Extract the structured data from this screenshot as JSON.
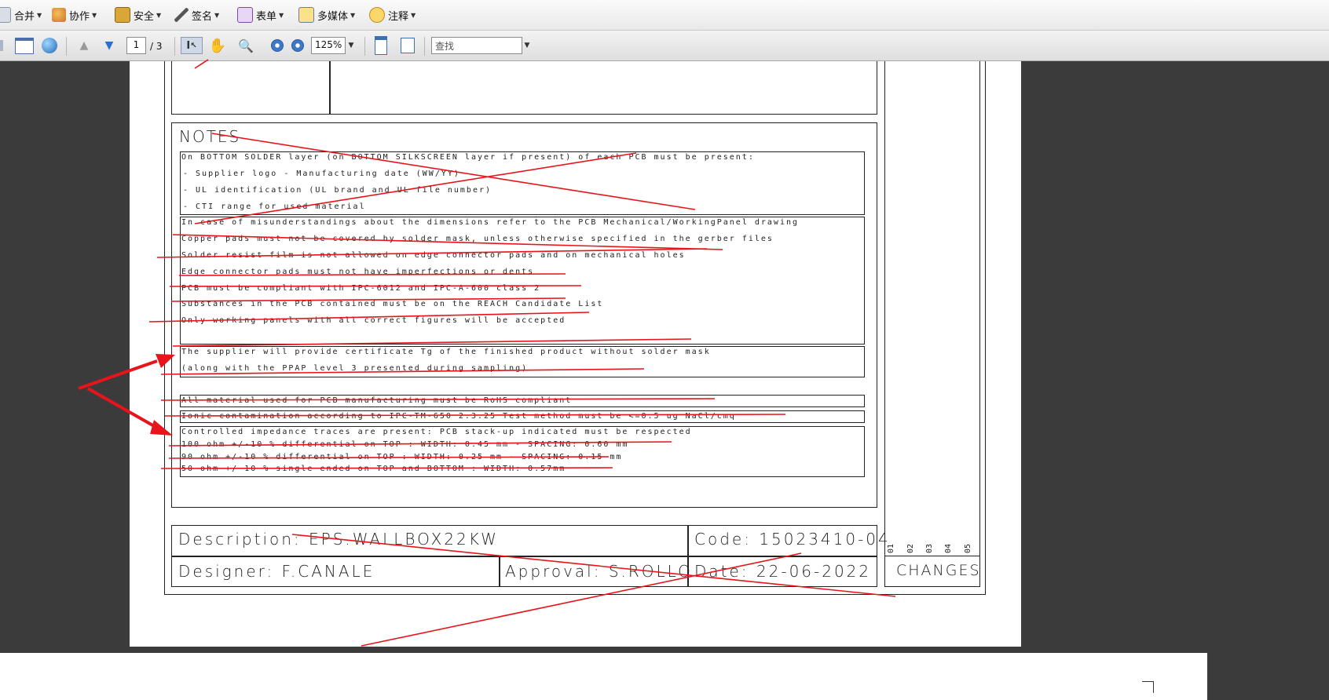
{
  "menubar": {
    "items": [
      {
        "label": "合并"
      },
      {
        "label": "协作"
      },
      {
        "label": "安全"
      },
      {
        "label": "签名"
      },
      {
        "label": "表单"
      },
      {
        "label": "多媒体"
      },
      {
        "label": "注释"
      }
    ]
  },
  "toolbar": {
    "page_current": "1",
    "page_total": "/ 3",
    "zoom": "125%",
    "search_placeholder": "查找"
  },
  "document": {
    "notes_title": "NOTES",
    "notes": [
      "On BOTTOM SOLDER layer (on BOTTOM SILKSCREEN layer if present) of each PCB must be present:",
      "- Supplier logo              - Manufacturing date (WW/YY)",
      "- UL identification (UL brand and UL file number)",
      "- CTI range for used material",
      "In case of misunderstandings about the dimensions refer to the PCB Mechanical/WorkingPanel drawing",
      "Copper pads must not be covered by solder mask, unless otherwise specified in the gerber files",
      "Solder resist film is not allowed on edge connector pads and on mechanical holes",
      "Edge connector pads must not have imperfections or dents",
      "PCB must be compliant with IPC-6012 and IPC-A-600 class 2",
      "Substances in the PCB contained must be on the REACH Candidate List",
      "Only working panels with all correct figures will be accepted",
      "The supplier will provide certificate Tg of the finished product without solder mask",
      "(along with the PPAP level 3 presented during sampling)",
      "All material used for PCB manufacturing must be RoHS compliant",
      "Ionic contamination according to IPC-TM-650 2.3.25 Test method must be <=0.5 ug NaCl/cmq",
      "Controlled impedance traces are present: PCB stack-up indicated must be respected",
      "100 ohm +/-10 % differential on TOP : WIDTH: 0.45 mm - SPACING: 0.60 mm",
      "90 ohm +/-10 % differential on TOP : WIDTH: 0.25 mm - SPACING: 0.15 mm",
      "50 ohm +/-10 % single ended on TOP and BOTTOM : WIDTH: 0.57mm"
    ],
    "title_block": {
      "description": "Description: EPS.WALLBOX22KW",
      "code": "Code: 15023410-04",
      "designer": "Designer: F.CANALE",
      "approval": "Approval: S.ROLLO",
      "date": "Date: 22-06-2022",
      "changes": "CHANGES",
      "revisions": [
        "01",
        "02",
        "03",
        "04",
        "05"
      ]
    }
  },
  "colors": {
    "annotation": "#e8141b",
    "background": "#3b3b3b"
  }
}
